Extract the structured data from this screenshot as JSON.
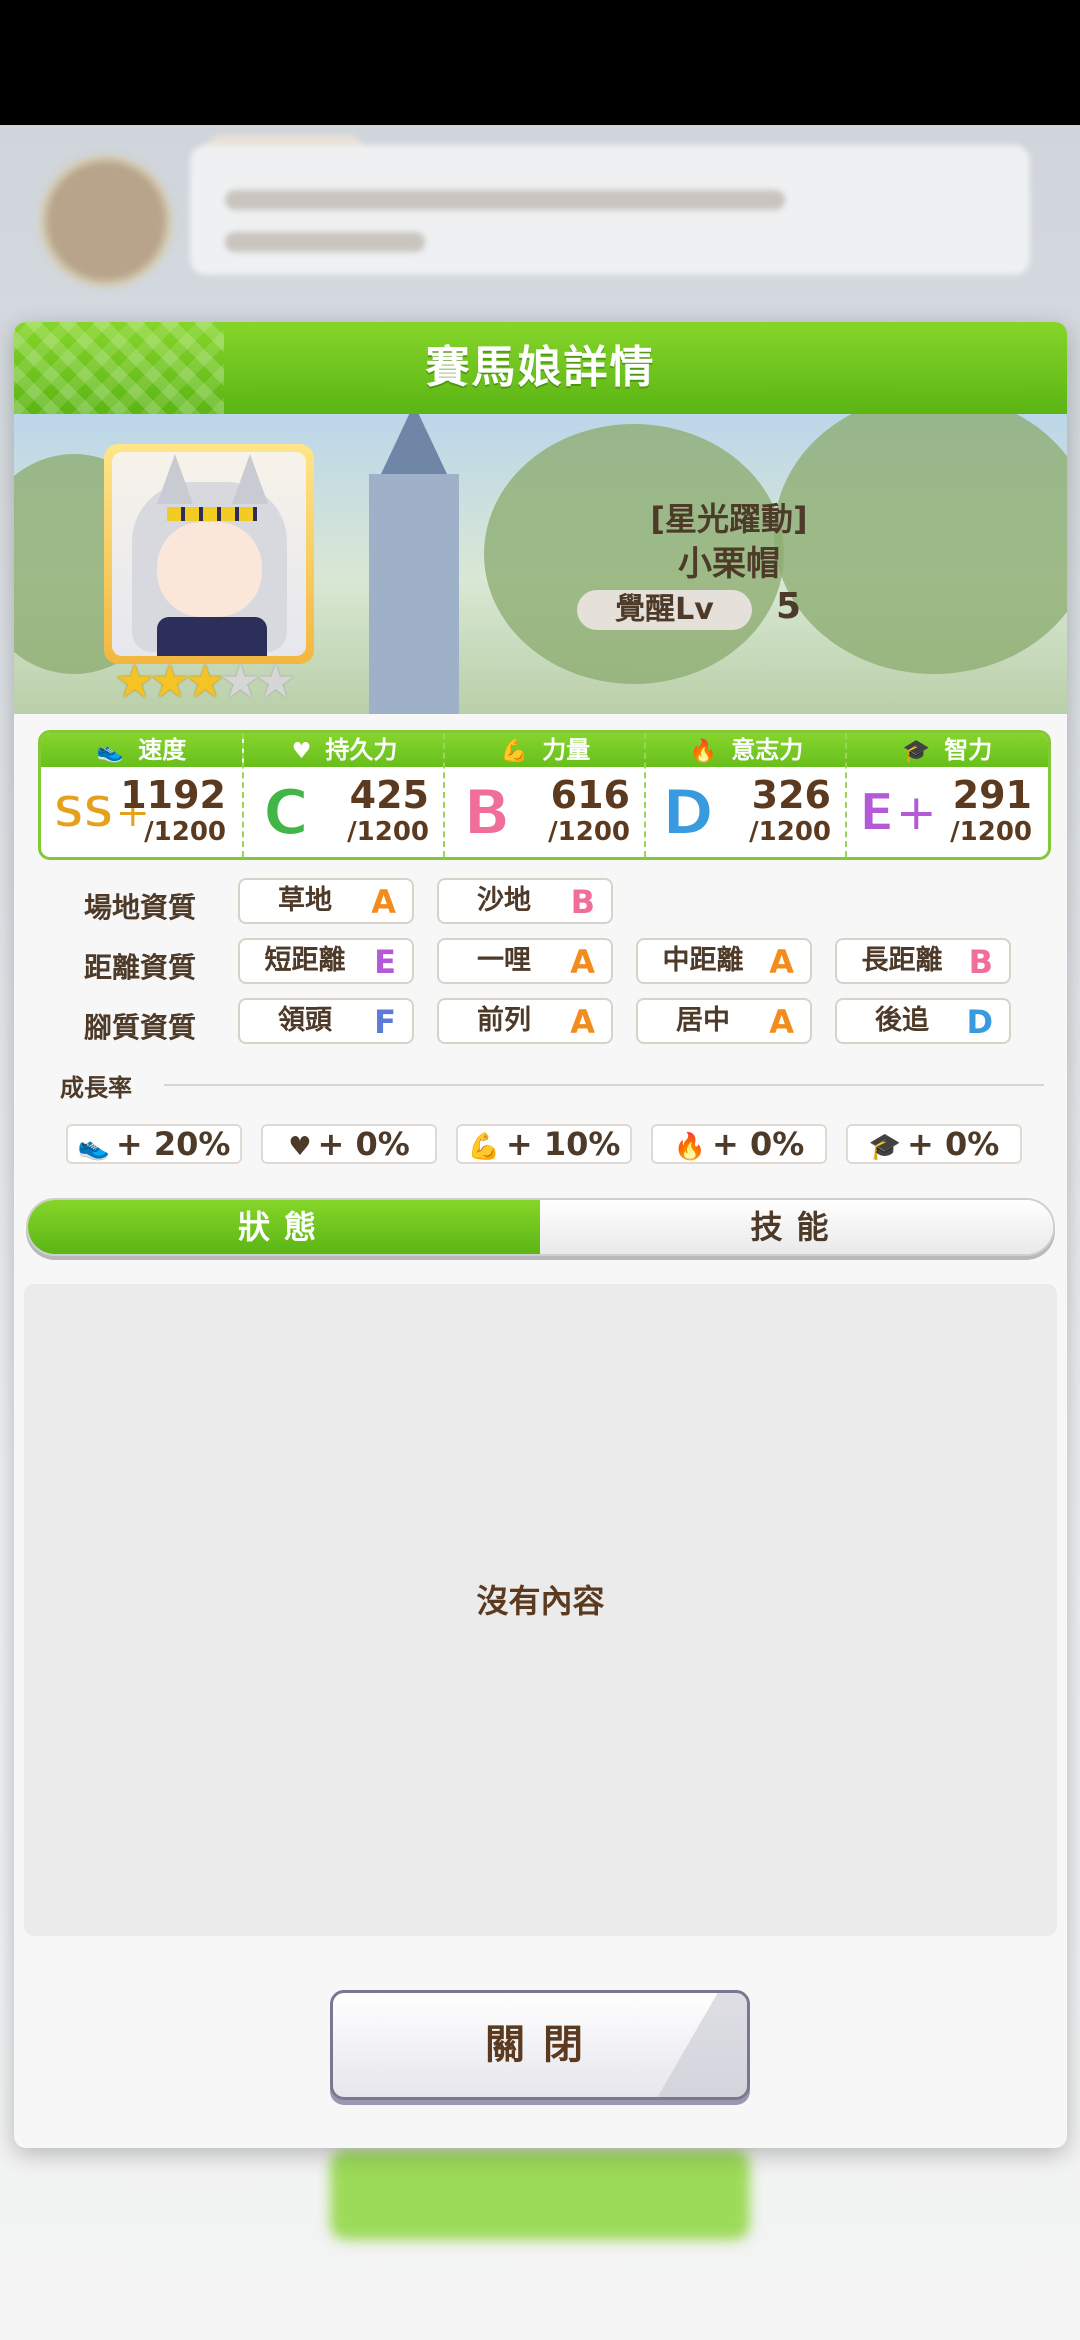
{
  "dialog": {
    "title": "賽馬娘詳情",
    "epithet": "[星光躍動]",
    "name": "小栗帽",
    "awakening_label": "覺醒Lv",
    "awakening_level": "5",
    "stars_filled": 3,
    "stars_total": 5
  },
  "stats": [
    {
      "label": "速度",
      "icon": "shoe-icon",
      "glyph": "⏷",
      "grade": "SS+",
      "value": "1192",
      "max": "/1200",
      "color": "#e4a21c"
    },
    {
      "label": "持久力",
      "icon": "heart-icon",
      "glyph": "♥",
      "grade": "C",
      "value": "425",
      "max": "/1200",
      "color": "#41b546"
    },
    {
      "label": "力量",
      "icon": "muscle-icon",
      "glyph": "💪",
      "grade": "B",
      "value": "616",
      "max": "/1200",
      "color": "#ef6f9a"
    },
    {
      "label": "意志力",
      "icon": "flame-icon",
      "glyph": "🔥",
      "grade": "D",
      "value": "326",
      "max": "/1200",
      "color": "#3a9ae0"
    },
    {
      "label": "智力",
      "icon": "graduation-cap-icon",
      "glyph": "🎓",
      "grade": "E+",
      "value": "291",
      "max": "/1200",
      "color": "#b45ad6"
    }
  ],
  "aptitude": {
    "track": {
      "label": "場地資質",
      "items": [
        {
          "name": "草地",
          "grade": "A"
        },
        {
          "name": "沙地",
          "grade": "B"
        }
      ]
    },
    "distance": {
      "label": "距離資質",
      "items": [
        {
          "name": "短距離",
          "grade": "E"
        },
        {
          "name": "一哩",
          "grade": "A"
        },
        {
          "name": "中距離",
          "grade": "A"
        },
        {
          "name": "長距離",
          "grade": "B"
        }
      ]
    },
    "style": {
      "label": "腳質資質",
      "items": [
        {
          "name": "領頭",
          "grade": "F"
        },
        {
          "name": "前列",
          "grade": "A"
        },
        {
          "name": "居中",
          "grade": "A"
        },
        {
          "name": "後追",
          "grade": "D"
        }
      ]
    }
  },
  "growth": {
    "label": "成長率",
    "items": [
      {
        "icon": "shoe-icon",
        "value": "+ 20%"
      },
      {
        "icon": "heart-icon",
        "value": "+ 0%"
      },
      {
        "icon": "muscle-icon",
        "value": "+ 10%"
      },
      {
        "icon": "flame-icon",
        "value": "+ 0%"
      },
      {
        "icon": "graduation-cap-icon",
        "value": "+ 0%"
      }
    ]
  },
  "tabs": {
    "status": "狀態",
    "skills": "技能",
    "active": "status"
  },
  "content": {
    "empty_text": "沒有內容"
  },
  "close_label": "關閉",
  "colors": {
    "accent_green": "#6cc31f",
    "text_brown": "#5b3a1f"
  }
}
